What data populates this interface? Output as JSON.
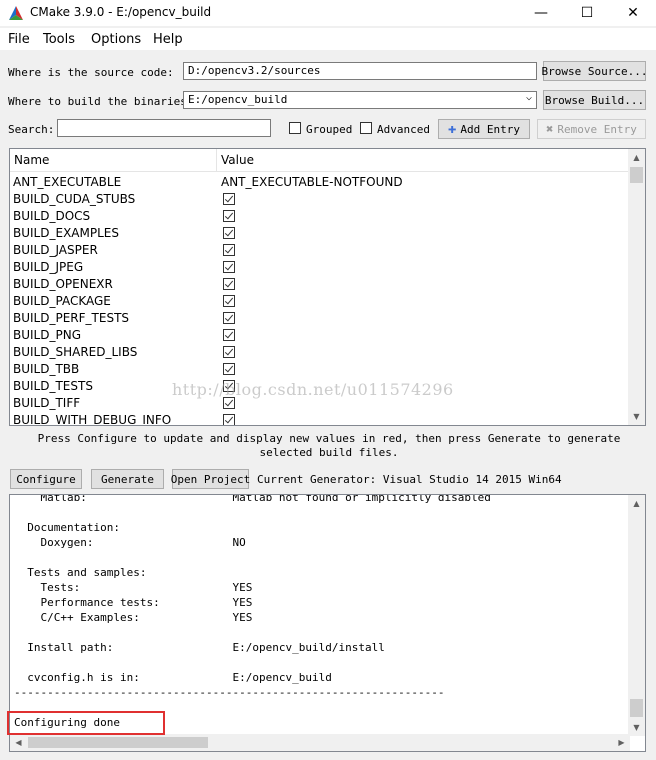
{
  "window": {
    "title": "CMake 3.9.0 - E:/opencv_build",
    "minimize": "—",
    "maximize": "☐",
    "close": "✕"
  },
  "menu": [
    "File",
    "Tools",
    "Options",
    "Help"
  ],
  "source": {
    "label": "Where is the source code:",
    "value": "D:/opencv3.2/sources",
    "browse": "Browse Source..."
  },
  "build": {
    "label": "Where to build the binaries:",
    "value": "E:/opencv_build",
    "browse": "Browse Build..."
  },
  "search": {
    "label": "Search:",
    "value": "",
    "grouped": "Grouped",
    "advanced": "Advanced",
    "add_entry": "Add Entry",
    "remove_entry": "Remove Entry"
  },
  "table": {
    "headers": {
      "name": "Name",
      "value": "Value"
    },
    "rows": [
      {
        "name": "ANT_EXECUTABLE",
        "value": "ANT_EXECUTABLE-NOTFOUND",
        "checkbox": false
      },
      {
        "name": "BUILD_CUDA_STUBS",
        "checkbox": true
      },
      {
        "name": "BUILD_DOCS",
        "checkbox": true
      },
      {
        "name": "BUILD_EXAMPLES",
        "checkbox": true
      },
      {
        "name": "BUILD_JASPER",
        "checkbox": true
      },
      {
        "name": "BUILD_JPEG",
        "checkbox": true
      },
      {
        "name": "BUILD_OPENEXR",
        "checkbox": true
      },
      {
        "name": "BUILD_PACKAGE",
        "checkbox": true
      },
      {
        "name": "BUILD_PERF_TESTS",
        "checkbox": true
      },
      {
        "name": "BUILD_PNG",
        "checkbox": true
      },
      {
        "name": "BUILD_SHARED_LIBS",
        "checkbox": true
      },
      {
        "name": "BUILD_TBB",
        "checkbox": true
      },
      {
        "name": "BUILD_TESTS",
        "checkbox": true
      },
      {
        "name": "BUILD_TIFF",
        "checkbox": true
      },
      {
        "name": "BUILD_WITH_DEBUG_INFO",
        "checkbox": true
      }
    ]
  },
  "watermark": "http://blog.csdn.net/u011574296",
  "hint": "Press Configure to update and display new values in red, then press Generate to generate selected build files.",
  "actions": {
    "configure": "Configure",
    "generate": "Generate",
    "open_project": "Open Project",
    "generator": "Current Generator: Visual Studio 14 2015 Win64"
  },
  "output_lines": [
    "    Matlab:                      Matlab not found or implicitly disabled",
    "",
    "  Documentation:",
    "    Doxygen:                     NO",
    "",
    "  Tests and samples:",
    "    Tests:                       YES",
    "    Performance tests:           YES",
    "    C/C++ Examples:              YES",
    "",
    "  Install path:                  E:/opencv_build/install",
    "",
    "  cvconfig.h is in:              E:/opencv_build",
    "-----------------------------------------------------------------",
    "",
    "Configuring done"
  ],
  "colors": {
    "highlight": "#e03030",
    "add_icon": "#3d6fd8"
  }
}
